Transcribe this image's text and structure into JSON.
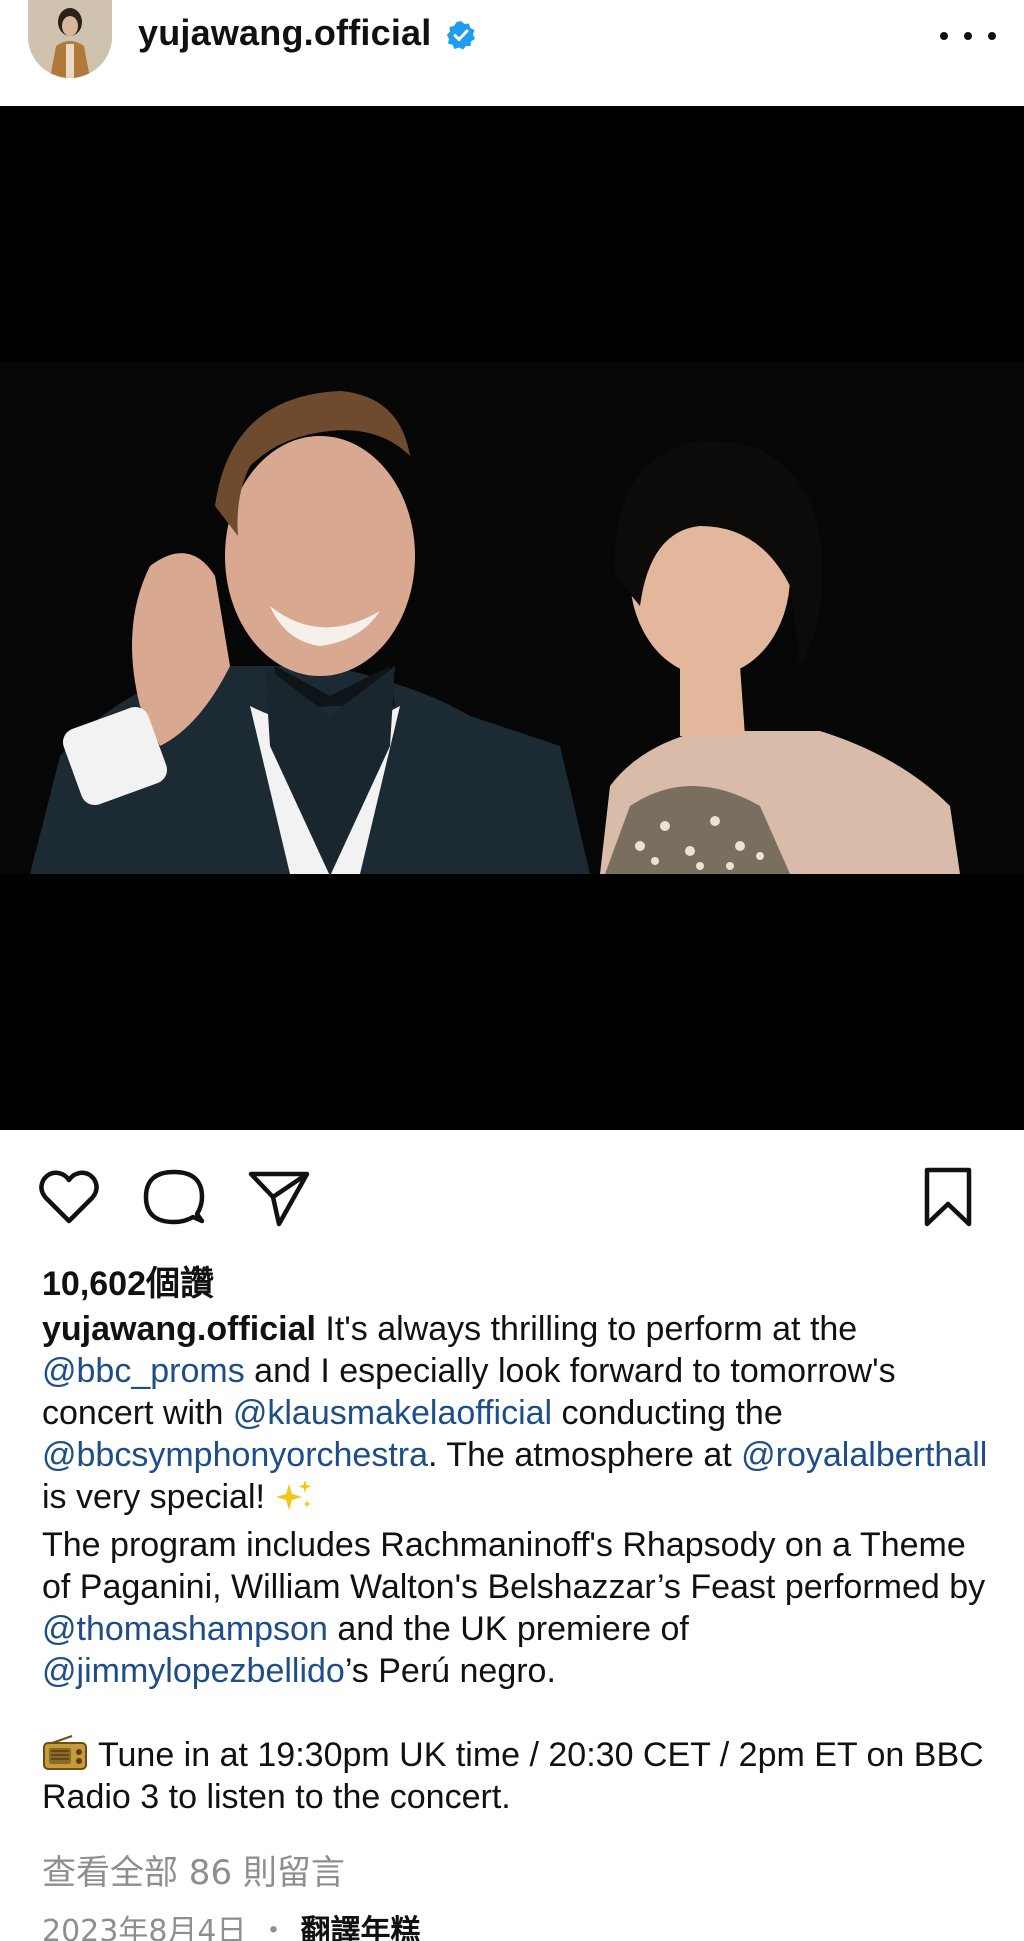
{
  "header": {
    "username": "yujawang.official",
    "verified_icon": "verified-badge-icon",
    "more_icon": "more-options-icon",
    "colors": {
      "verified": "#1f9cf0"
    }
  },
  "post": {
    "image_description_icon": "post-photo"
  },
  "actions": {
    "like_icon": "heart-icon",
    "comment_icon": "comment-bubble-icon",
    "share_icon": "paper-plane-icon",
    "save_icon": "bookmark-icon"
  },
  "likes": {
    "text": "10,602個讚"
  },
  "caption": {
    "username": "yujawang.official",
    "p1": " It's always thrilling to perform at the ",
    "m1": "@bbc_proms",
    "p2": " and I especially look forward to tomorrow's concert with ",
    "m2": "@klausmakelaofficial",
    "p3": " conducting the ",
    "m3": "@bbcsymphonyorchestra",
    "p4": ". The atmosphere at ",
    "m4": "@royalalberthall",
    "p5": " is very special!",
    "p6": "The program includes Rachmaninoff's Rhapsody on a Theme of Paganini, William Walton's Belshazzar’s Feast performed by ",
    "m5": "@thomashampson",
    "p7": " and the UK premiere of ",
    "m6": "@jimmylopezbellido",
    "p8": "’s Perú negro.",
    "p9": "Tune in at 19:30pm UK time / 20:30 CET / 2pm ET on BBC Radio 3 to listen to the concert.",
    "mention_color": "#1d4e89"
  },
  "comments": {
    "view_all": "查看全部 86 則留言"
  },
  "meta": {
    "date": "2023年8月4日",
    "separator": "・",
    "translate": "翻譯年糕"
  }
}
